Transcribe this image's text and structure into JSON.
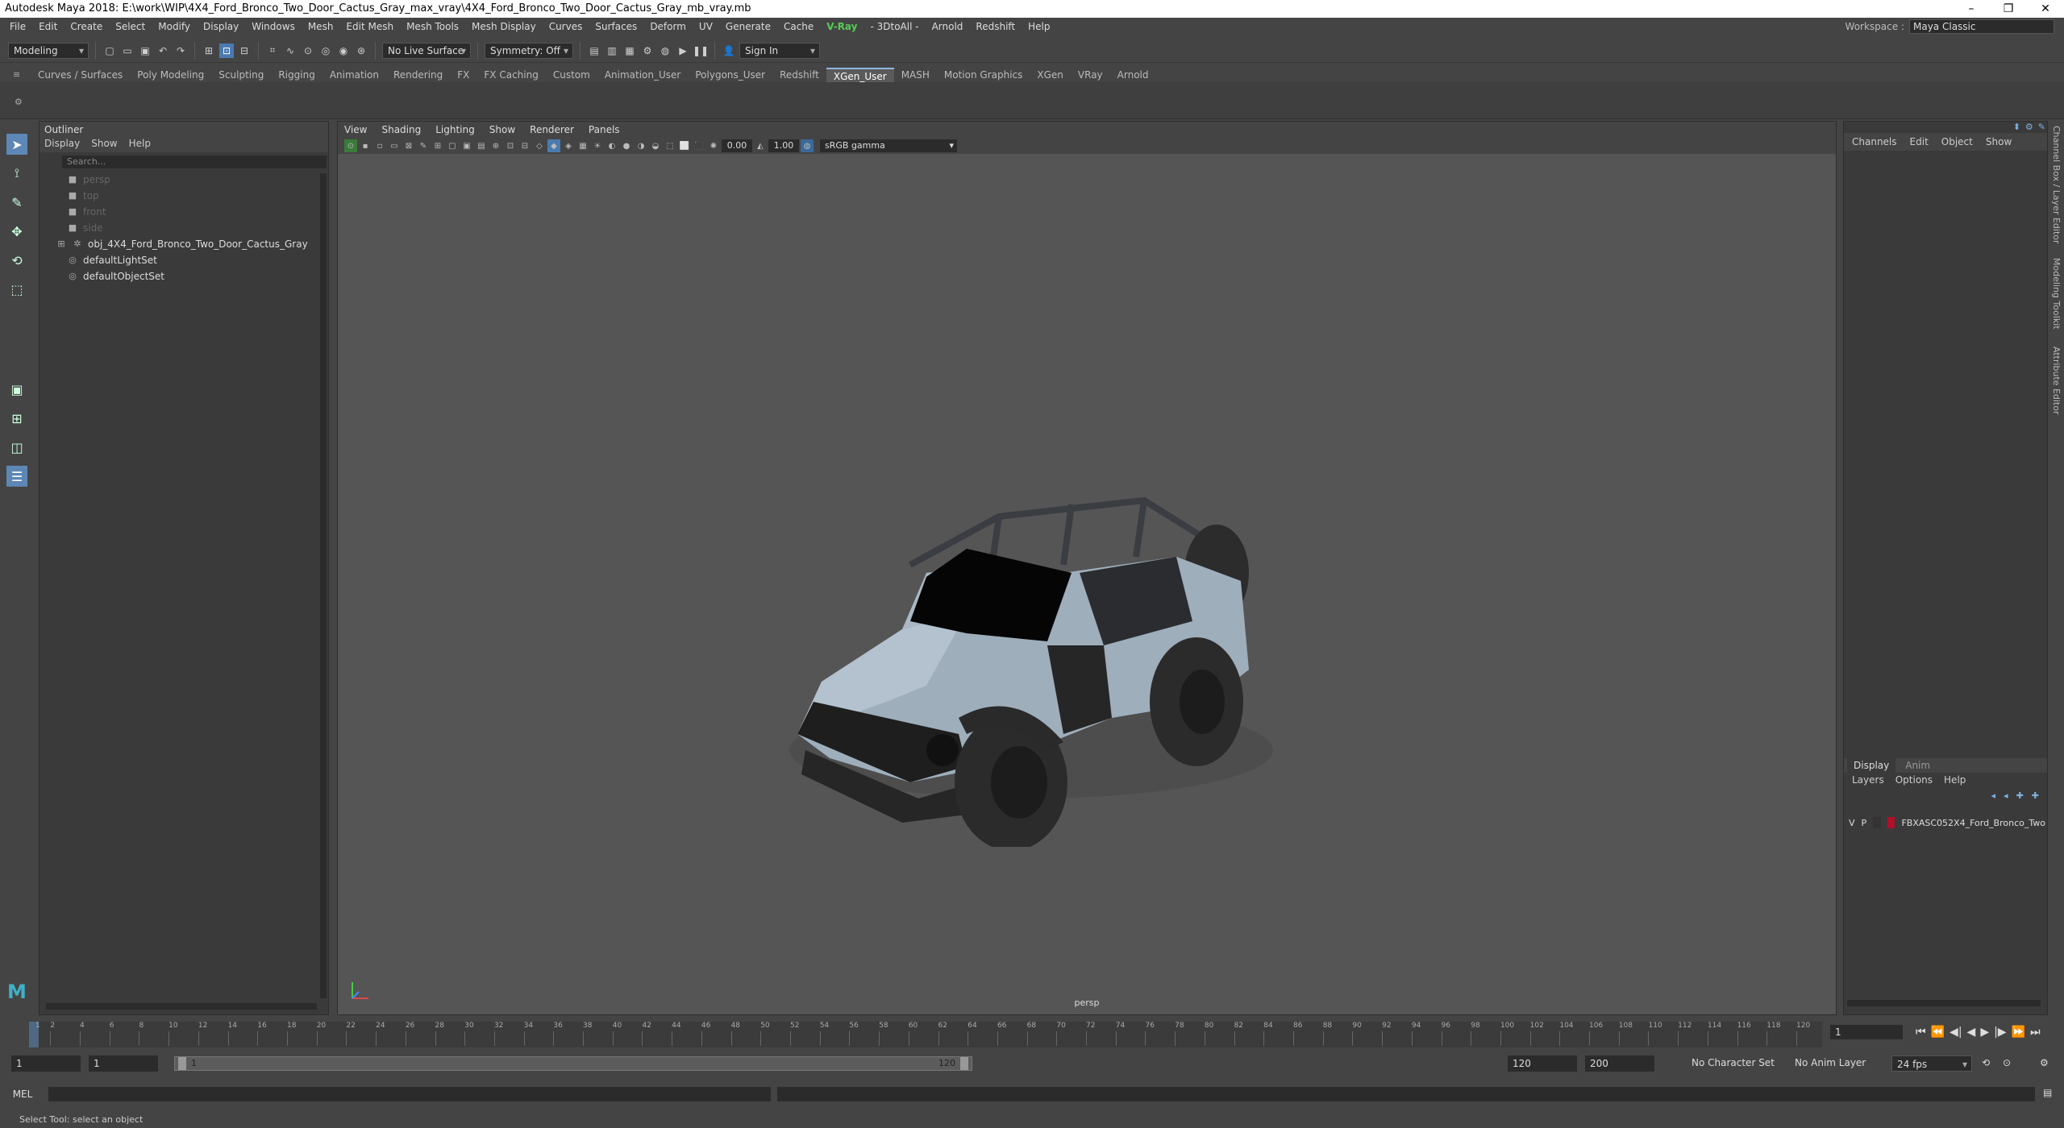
{
  "window": {
    "title": "Autodesk Maya 2018: E:\\work\\WIP\\4X4_Ford_Bronco_Two_Door_Cactus_Gray_max_vray\\4X4_Ford_Bronco_Two_Door_Cactus_Gray_mb_vray.mb",
    "controls": [
      "–",
      "❐",
      "✕"
    ]
  },
  "menubar": [
    "File",
    "Edit",
    "Create",
    "Select",
    "Modify",
    "Display",
    "Windows",
    "Mesh",
    "Edit Mesh",
    "Mesh Tools",
    "Mesh Display",
    "Curves",
    "Surfaces",
    "Deform",
    "UV",
    "Generate",
    "Cache",
    "V-Ray",
    "- 3DtoAll -",
    "Arnold",
    "Redshift",
    "Help"
  ],
  "workspace": {
    "label": "Workspace :",
    "value": "Maya Classic"
  },
  "toolbar": {
    "mode": "Modeling",
    "live_surface": "No Live Surface",
    "symmetry": "Symmetry: Off",
    "sign_in": "Sign In"
  },
  "shelf_tabs": [
    "Curves / Surfaces",
    "Poly Modeling",
    "Sculpting",
    "Rigging",
    "Animation",
    "Rendering",
    "FX",
    "FX Caching",
    "Custom",
    "Animation_User",
    "Polygons_User",
    "Redshift",
    "XGen_User",
    "MASH",
    "Motion Graphics",
    "XGen",
    "VRay",
    "Arnold"
  ],
  "shelf_active": "XGen_User",
  "outliner": {
    "title": "Outliner",
    "menu": [
      "Display",
      "Show",
      "Help"
    ],
    "search_placeholder": "Search...",
    "items": [
      {
        "label": "persp",
        "dim": true
      },
      {
        "label": "top",
        "dim": true
      },
      {
        "label": "front",
        "dim": true
      },
      {
        "label": "side",
        "dim": true
      },
      {
        "label": "obj_4X4_Ford_Bronco_Two_Door_Cactus_Gray",
        "dim": false
      },
      {
        "label": "defaultLightSet",
        "dim": false
      },
      {
        "label": "defaultObjectSet",
        "dim": false
      }
    ]
  },
  "viewport": {
    "menu": [
      "View",
      "Shading",
      "Lighting",
      "Show",
      "Renderer",
      "Panels"
    ],
    "exposure": "0.00",
    "gamma_value": "1.00",
    "color_space": "sRGB gamma",
    "camera": "persp"
  },
  "channel_box": {
    "menu": [
      "Channels",
      "Edit",
      "Object",
      "Show"
    ],
    "side_tabs": [
      "Channel Box / Layer Editor",
      "Modeling Toolkit",
      "Attribute Editor"
    ]
  },
  "layer_editor": {
    "tabs": [
      "Display",
      "Anim"
    ],
    "menu": [
      "Layers",
      "Options",
      "Help"
    ],
    "layer": {
      "v": "V",
      "p": "P",
      "name": "FBXASC052X4_Ford_Bronco_Two",
      "color": "#b0102a"
    }
  },
  "timeline": {
    "ticks": [
      "1",
      "2",
      "4",
      "6",
      "8",
      "10",
      "12",
      "14",
      "16",
      "18",
      "20",
      "22",
      "24",
      "26",
      "28",
      "30",
      "32",
      "34",
      "36",
      "38",
      "40",
      "42",
      "44",
      "46",
      "48",
      "50",
      "52",
      "54",
      "56",
      "58",
      "60",
      "62",
      "64",
      "66",
      "68",
      "70",
      "72",
      "74",
      "76",
      "78",
      "80",
      "82",
      "84",
      "86",
      "88",
      "90",
      "92",
      "94",
      "96",
      "98",
      "100",
      "102",
      "104",
      "106",
      "108",
      "110",
      "112",
      "114",
      "116",
      "118",
      "120"
    ],
    "current_frame": "1"
  },
  "range": {
    "start": "1",
    "playback_start": "1",
    "bar_start": "1",
    "bar_end": "120",
    "playback_end": "120",
    "end": "200",
    "character_set": "No Character Set",
    "anim_layer": "No Anim Layer",
    "fps": "24 fps"
  },
  "command": {
    "label": "MEL"
  },
  "status": "Select Tool: select an object"
}
